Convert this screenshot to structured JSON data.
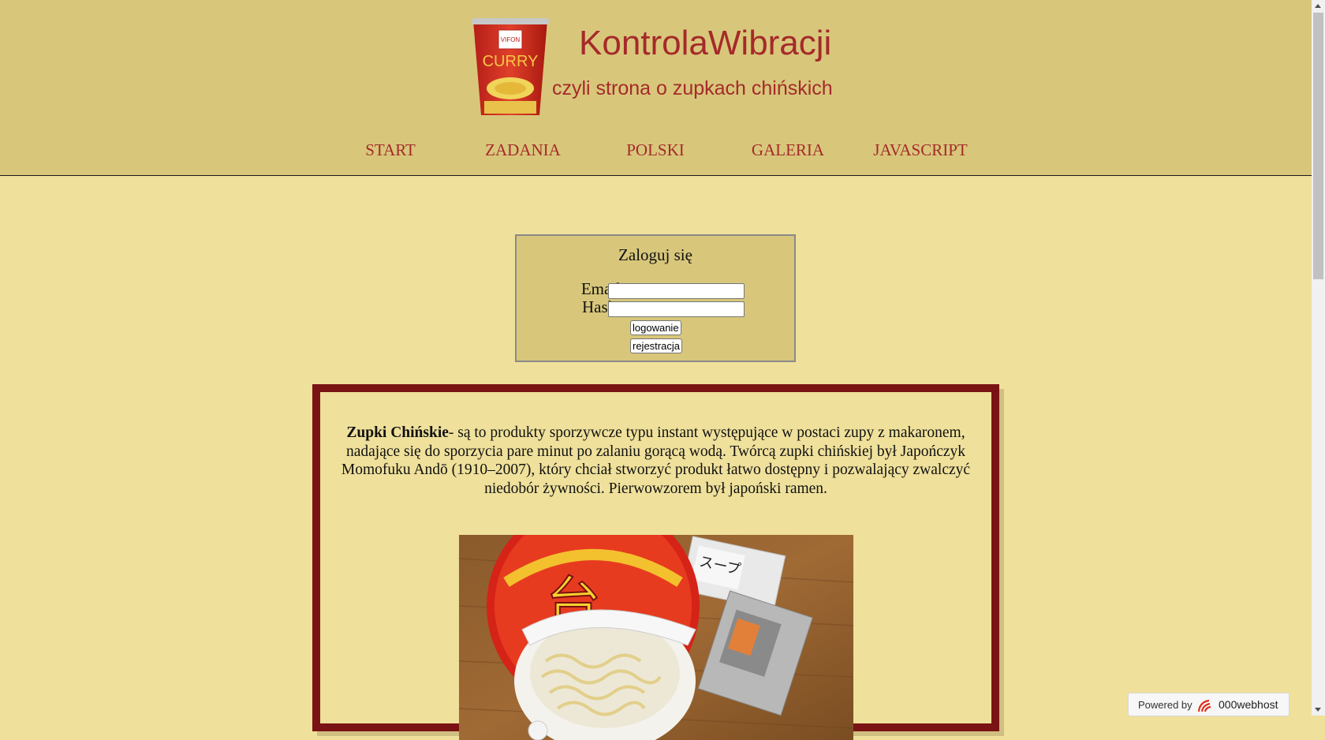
{
  "header": {
    "logo_label_brand": "VIFON",
    "logo_label_flavor": "CURRY",
    "title": "KontrolaWibracji",
    "subtitle": "czyli strona o zupkach chińskich",
    "title_color": "#a52a2a",
    "background": "#d8c77b"
  },
  "nav": {
    "items": [
      {
        "label": "START"
      },
      {
        "label": "ZADANIA"
      },
      {
        "label": "POLSKI"
      },
      {
        "label": "GALERIA"
      },
      {
        "label": "JAVASCRIPT"
      }
    ]
  },
  "login": {
    "title": "Zaloguj się",
    "email_label": "Email",
    "email_value": "",
    "password_label": "Hasło",
    "password_value": "",
    "login_button": "logowanie",
    "register_button": "rejestracja"
  },
  "article": {
    "term": "Zupki Chińskie",
    "text": "- są to produkty sporzywcze typu instant występujące w postaci zupy z makaronem, nadające się do sporzycia pare minut po zalaniu gorącą wodą. Twórcą zupki chińskiej był Japończyk Momofuku Andō (1910–2007), który chciał stworzyć produkt łatwo dostępny i pozwalający zwalczyć niedobór żywności. Pierwowzorem był japoński ramen.",
    "border_color": "#7a1414",
    "photo_icon": "instant-noodle-cup-photo"
  },
  "badge": {
    "powered_by": "Powered by",
    "brand": "000webhost"
  },
  "colors": {
    "page_background": "#efe09b",
    "nav_color": "#a52a2a"
  }
}
